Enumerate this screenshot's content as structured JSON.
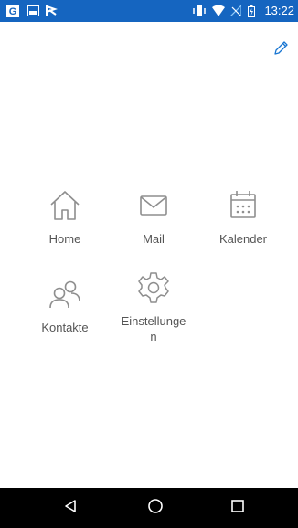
{
  "status_bar": {
    "time": "13:22",
    "left_icons": [
      "g-app-icon",
      "image-icon",
      "flag-icon"
    ],
    "right_icons": [
      "vibrate-icon",
      "wifi-icon",
      "no-sim-icon",
      "battery-icon"
    ],
    "color": "#1565c0"
  },
  "toolbar": {
    "edit_icon": "pencil-icon",
    "accent": "#1976d2"
  },
  "tiles": [
    {
      "label": "Home",
      "icon": "home-icon"
    },
    {
      "label": "Mail",
      "icon": "mail-icon"
    },
    {
      "label": "Kalender",
      "icon": "calendar-icon"
    },
    {
      "label": "Kontakte",
      "icon": "contacts-icon"
    },
    {
      "label": "Einstellunge\nn",
      "icon": "gear-icon"
    }
  ],
  "nav_bar": {
    "buttons": [
      "back-icon",
      "home-circle-icon",
      "recents-icon"
    ]
  }
}
